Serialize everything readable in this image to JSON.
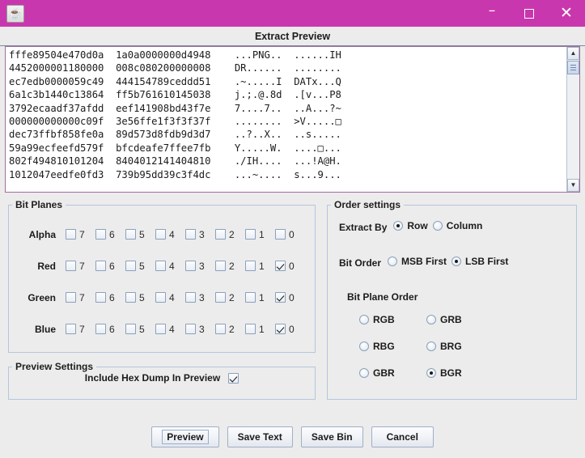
{
  "window": {
    "icon_name": "java-coffee-cup-icon",
    "titlebar_color": "#c937ae",
    "minimize_label": "–",
    "maximize_label": "",
    "close_label": "✕"
  },
  "dialog": {
    "title": "Extract Preview"
  },
  "hexdump": {
    "lines": [
      "fffe89504e470d0a  1a0a0000000d4948    ...PNG..  ......IH",
      "4452000001180000  008c080200000008    DR......  ........",
      "ec7edb0000059c49  444154789ceddd51    .~.....I  DATx...Q",
      "6a1c3b1440c13864  ff5b761610145038    j.;.@.8d  .[v...P8",
      "3792ecaadf37afdd  eef141908bd43f7e    7....7..  ..A...?~",
      "000000000000c09f  3e56ffe1f3f3f37f    ........  >V.....□",
      "dec73ffbf858fe0a  89d573d8fdb9d3d7    ..?..X..  ..s.....",
      "59a99ecfeefd579f  bfcdeafe7ffee7fb    Y.....W.  ....□...",
      "802f494810101204  8404012141404810    ./IH....  ...!A@H.",
      "1012047eedfe0fd3  739b95dd39c3f4dc    ...~....  s...9..."
    ],
    "scrollbar": {
      "up_arrow": "▲",
      "down_arrow": "▼"
    }
  },
  "bit_planes": {
    "legend": "Bit Planes",
    "bit_labels": [
      "7",
      "6",
      "5",
      "4",
      "3",
      "2",
      "1",
      "0"
    ],
    "rows": [
      {
        "label": "Alpha",
        "checked": [
          false,
          false,
          false,
          false,
          false,
          false,
          false,
          false
        ]
      },
      {
        "label": "Red",
        "checked": [
          false,
          false,
          false,
          false,
          false,
          false,
          false,
          true
        ]
      },
      {
        "label": "Green",
        "checked": [
          false,
          false,
          false,
          false,
          false,
          false,
          false,
          true
        ]
      },
      {
        "label": "Blue",
        "checked": [
          false,
          false,
          false,
          false,
          false,
          false,
          false,
          true
        ]
      }
    ]
  },
  "preview_settings": {
    "legend": "Preview Settings",
    "include_hex_dump_label": "Include Hex Dump In Preview",
    "include_hex_dump_checked": true
  },
  "order_settings": {
    "legend": "Order settings",
    "extract_by": {
      "label": "Extract By",
      "options": [
        {
          "label": "Row",
          "selected": true
        },
        {
          "label": "Column",
          "selected": false
        }
      ]
    },
    "bit_order": {
      "label": "Bit Order",
      "options": [
        {
          "label": "MSB First",
          "selected": false
        },
        {
          "label": "LSB First",
          "selected": true
        }
      ]
    },
    "bit_plane_order": {
      "label": "Bit Plane Order",
      "options": [
        {
          "label": "RGB",
          "selected": false
        },
        {
          "label": "GRB",
          "selected": false
        },
        {
          "label": "RBG",
          "selected": false
        },
        {
          "label": "BRG",
          "selected": false
        },
        {
          "label": "GBR",
          "selected": false
        },
        {
          "label": "BGR",
          "selected": true
        }
      ]
    }
  },
  "buttons": {
    "preview": "Preview",
    "save_text": "Save Text",
    "save_bin": "Save Bin",
    "cancel": "Cancel"
  }
}
